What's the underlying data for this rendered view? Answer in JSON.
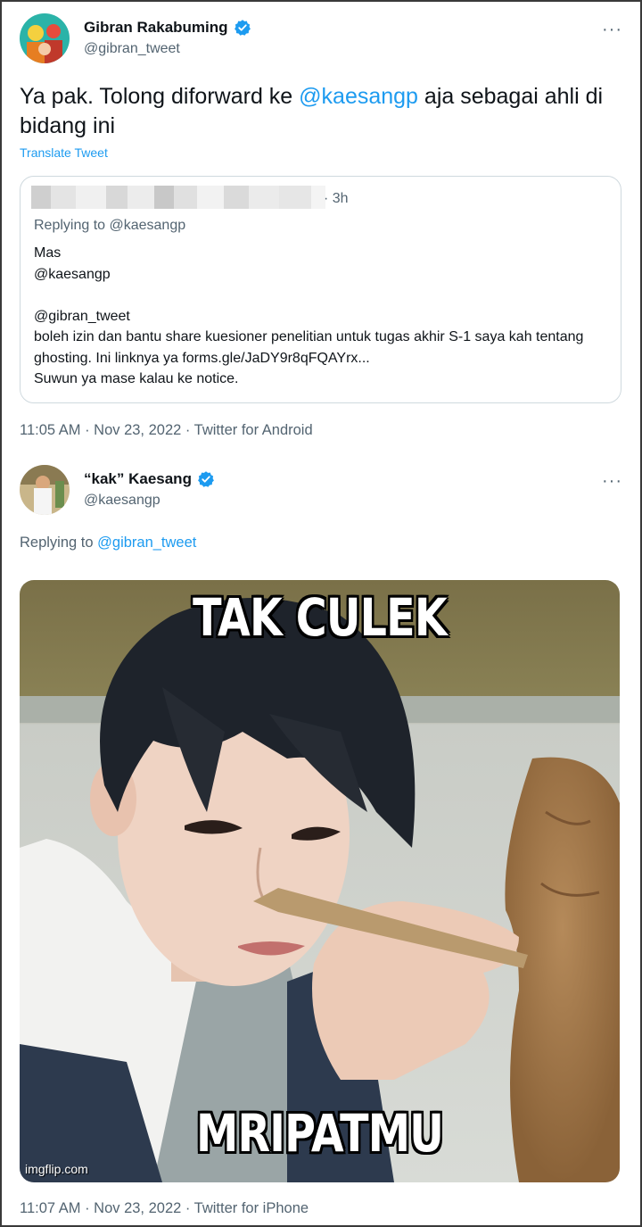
{
  "tweet1": {
    "display_name": "Gibran Rakabuming",
    "handle": "@gibran_tweet",
    "text_before": "Ya pak. Tolong diforward ke ",
    "mention": "@kaesangp",
    "text_after": " aja sebagai ahli di bidang ini",
    "translate_label": "Translate Tweet",
    "quote": {
      "time": "· 3h",
      "replying_to": "Replying to @kaesangp",
      "body": "Mas\n@kaesangp\n\n@gibran_tweet\n boleh izin dan bantu share kuesioner penelitian untuk tugas akhir S-1 saya kah tentang ghosting. Ini linknya ya forms.gle/JaDY9r8qFQAYrx...\nSuwun ya mase kalau ke notice."
    },
    "meta": "11:05 AM · Nov 23, 2022 · Twitter for Android",
    "more_icon": "more-horizontal-icon",
    "verified_icon": "verified-badge-icon"
  },
  "tweet2": {
    "display_name": "“kak” Kaesang",
    "handle": "@kaesangp",
    "replying_prefix": "Replying to ",
    "replying_mention": "@gibran_tweet",
    "media": {
      "top_caption": "TAK CULEK",
      "bottom_caption": "MRIPATMU",
      "watermark": "imgflip.com"
    },
    "meta": "11:07 AM · Nov 23, 2022 · Twitter for iPhone"
  },
  "colors": {
    "accent": "#1d9bf0",
    "secondary_text": "#536471",
    "border": "#cfd9de"
  }
}
